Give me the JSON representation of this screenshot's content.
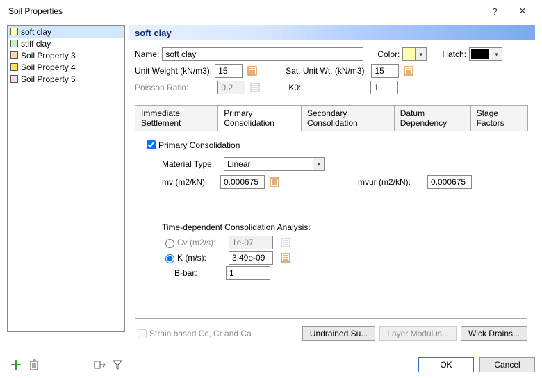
{
  "window": {
    "title": "Soil Properties",
    "help": "?",
    "close": "✕"
  },
  "sidebar_items": [
    {
      "label": "soft clay",
      "color": "#ffffb0",
      "selected": true
    },
    {
      "label": "stiff clay",
      "color": "#c8f0c8",
      "selected": false
    },
    {
      "label": "Soil Property 3",
      "color": "#ffd8b0",
      "selected": false
    },
    {
      "label": "Soil Property 4",
      "color": "#ffe060",
      "selected": false
    },
    {
      "label": "Soil Property 5",
      "color": "#ffd8e0",
      "selected": false
    }
  ],
  "heading": "soft clay",
  "name_label": "Name:",
  "name_value": "soft clay",
  "color_label": "Color:",
  "color_value": "#ffffb0",
  "hatch_label": "Hatch:",
  "hatch_value": "#000000",
  "unit_weight_label": "Unit Weight (kN/m3):",
  "unit_weight_value": "15",
  "sat_unit_label": "Sat. Unit Wt. (kN/m3)",
  "sat_unit_value": "15",
  "poisson_label": "Poisson Ratio:",
  "poisson_value": "0.2",
  "k0_label": "K0:",
  "k0_value": "1",
  "tabs": {
    "t0": "Immediate Settlement",
    "t1": "Primary Consolidation",
    "t2": "Secondary Consolidation",
    "t3": "Datum Dependency",
    "t4": "Stage Factors"
  },
  "pc_checkbox": "Primary Consolidation",
  "material_type_label": "Material Type:",
  "material_type_value": "Linear",
  "mv_label": "mv (m2/kN):",
  "mv_value": "0.000675",
  "mvur_label": "mvur (m2/kN):",
  "mvur_value": "0.000675",
  "tdca_label": "Time-dependent Consolidation Analysis:",
  "cv_label": "Cv (m2/s):",
  "cv_value": "1e-07",
  "k_label": "K (m/s):",
  "k_value": "3.49e-09",
  "bbar_label": "B-bar:",
  "bbar_value": "1",
  "strain_based_label": "Strain based Cc, Cr and Ca",
  "btn_undrained": "Undrained Su...",
  "btn_layermod": "Layer Modulus...",
  "btn_wick": "Wick Drains...",
  "btn_ok": "OK",
  "btn_cancel": "Cancel"
}
